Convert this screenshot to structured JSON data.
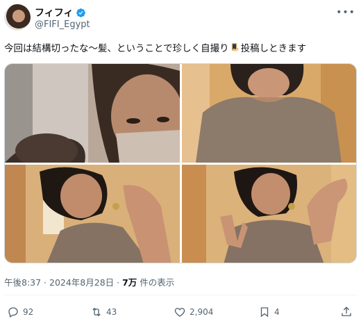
{
  "author": {
    "display_name": "フィフィ",
    "handle": "@FIFI_Egypt",
    "verified": true
  },
  "tweet": {
    "text_before_emoji": "今回は結構切ったな〜髪、ということで珍しく自撮り",
    "emoji": "selfie-emoji",
    "text_after_emoji": "投稿しときます"
  },
  "photos": [
    {
      "name": "photo-1",
      "description_icon": "photo"
    },
    {
      "name": "photo-2",
      "description_icon": "photo"
    },
    {
      "name": "photo-3",
      "description_icon": "photo"
    },
    {
      "name": "photo-4",
      "description_icon": "photo"
    }
  ],
  "meta": {
    "time": "午後8:37 · 2024年8月28日 · ",
    "views_count": "7万",
    "views_label": " 件の表示"
  },
  "actions": {
    "replies": "92",
    "retweets": "43",
    "likes": "2,904",
    "bookmarks": "4"
  },
  "colors": {
    "verified": "#1d9bf0",
    "text": "#0f1419",
    "secondary": "#536471"
  }
}
